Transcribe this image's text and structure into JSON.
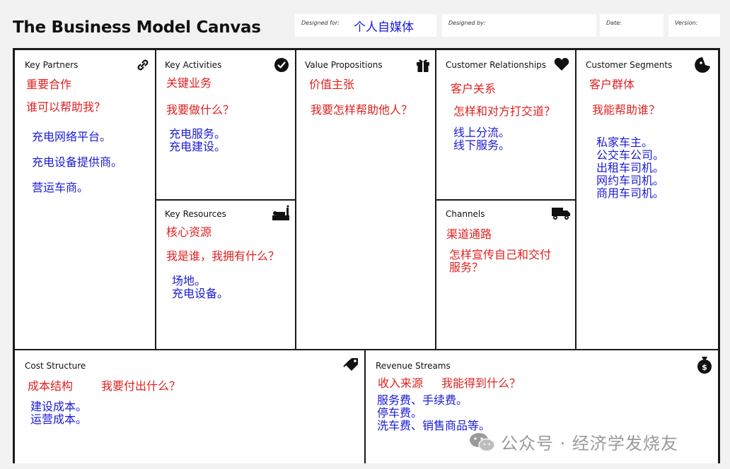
{
  "title": "The Business Model Canvas",
  "meta": {
    "designed_for_label": "Designed for:",
    "designed_for_value": "个人自媒体",
    "designed_by_label": "Designed by:",
    "date_label": "Date:",
    "version_label": "Version:"
  },
  "key_partners": {
    "header": "Key Partners",
    "q1": "重要合作",
    "q2": "谁可以帮助我？",
    "a1": "充电网络平台。",
    "a2": "充电设备提供商。",
    "a3": "营运车商。"
  },
  "key_activities": {
    "header": "Key Activities",
    "q1": "关键业务",
    "q2": "我要做什么？",
    "answer": "充电服务。\n充电建设。"
  },
  "key_resources": {
    "header": "Key Resources",
    "q1": "核心资源",
    "q2": "我是谁，我拥有什么？",
    "answer": "场地。\n充电设备。"
  },
  "value_propositions": {
    "header": "Value Propositions",
    "q1": "价值主张",
    "q2": "我要怎样帮助他人？"
  },
  "customer_relationships": {
    "header": "Customer Relationships",
    "q1": "客户关系",
    "q2": "怎样和对方打交道？",
    "answer": "线上分流。\n线下服务。"
  },
  "channels": {
    "header": "Channels",
    "q1": "渠道通路",
    "q2": "怎样宣传自己和交付\n服务？"
  },
  "customer_segments": {
    "header": "Customer Segments",
    "q1": "客户群体",
    "q2": "我能帮助谁？",
    "answer": "私家车主。\n公交车公司。\n出租车司机。\n网约车司机。\n商用车司机。"
  },
  "cost_structure": {
    "header": "Cost Structure",
    "q1": "成本结构",
    "q2": "我要付出什么？",
    "answer": "建设成本。\n运营成本。"
  },
  "revenue_streams": {
    "header": "Revenue Streams",
    "q1": "收入来源",
    "q2": "我能得到什么？",
    "answer": "服务费、手续费。\n停车费。\n洗车费、销售商品等。"
  },
  "watermark": "公众号 · 经济学发烧友",
  "colors": {
    "question": "#e02020",
    "answer": "#1a1ad6",
    "border": "#1a1a1a"
  },
  "icons": [
    "link-icon",
    "check-circle-icon",
    "factory-icon",
    "gift-icon",
    "heart-icon",
    "truck-icon",
    "face-icon",
    "tag-icon",
    "money-bag-icon",
    "wechat-icon"
  ]
}
